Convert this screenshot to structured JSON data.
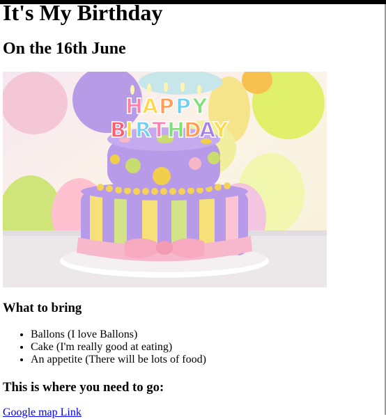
{
  "page": {
    "title": "It's My Birthday",
    "subtitle": "On the 16th June"
  },
  "image": {
    "icon": "birthday-cake-photo"
  },
  "bring": {
    "heading": "What to bring",
    "items": [
      "Ballons (I love Ballons)",
      "Cake (I'm really good at eating)",
      "An appetite (There will be lots of food)"
    ]
  },
  "location": {
    "heading": "This is where you need to go:",
    "link_text": "Google map Link"
  },
  "colors": {
    "link": "#0000ee",
    "text": "#000000"
  }
}
